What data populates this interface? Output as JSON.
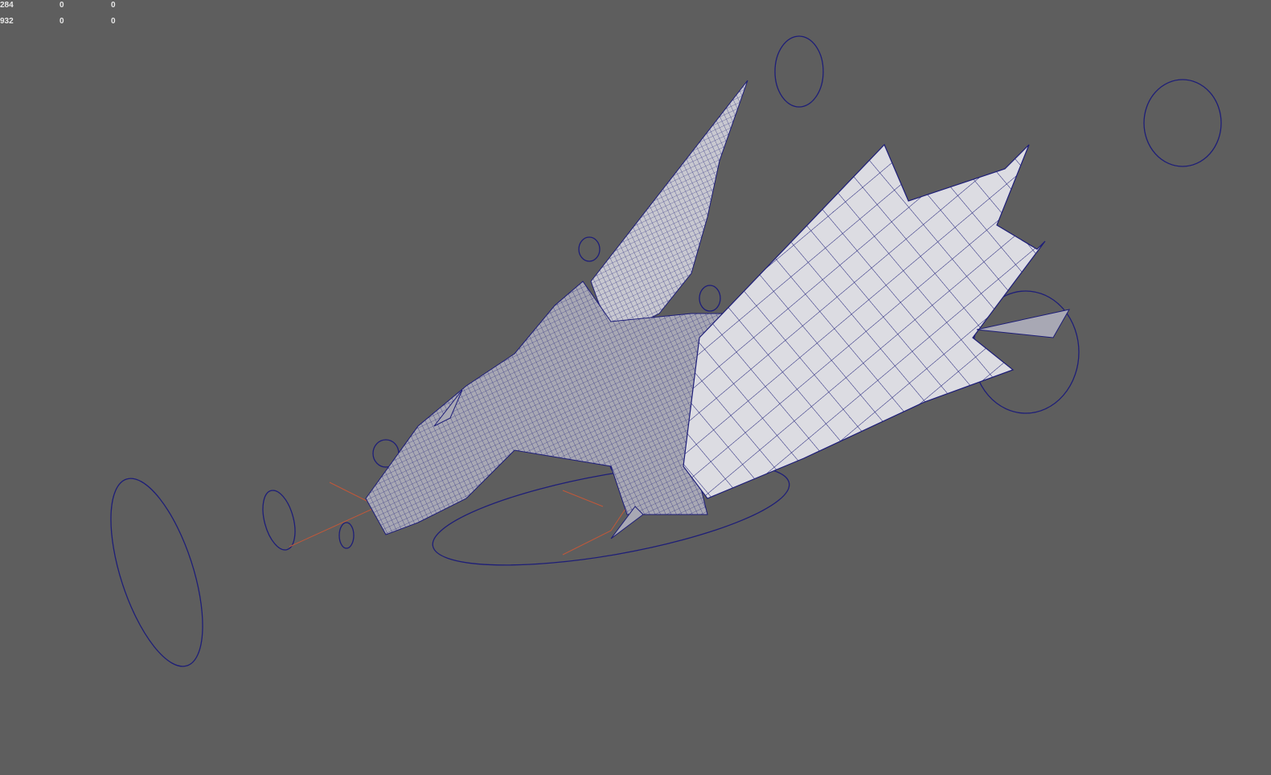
{
  "hud": {
    "rows": [
      {
        "a": "284",
        "b": "0",
        "c": "0"
      },
      {
        "a": "932",
        "b": "0",
        "c": "0"
      }
    ]
  },
  "colors": {
    "background": "#5e5e5e",
    "wireframe": "#1e1e78",
    "surface": "#d9d9de",
    "joint": "#c0583a"
  }
}
